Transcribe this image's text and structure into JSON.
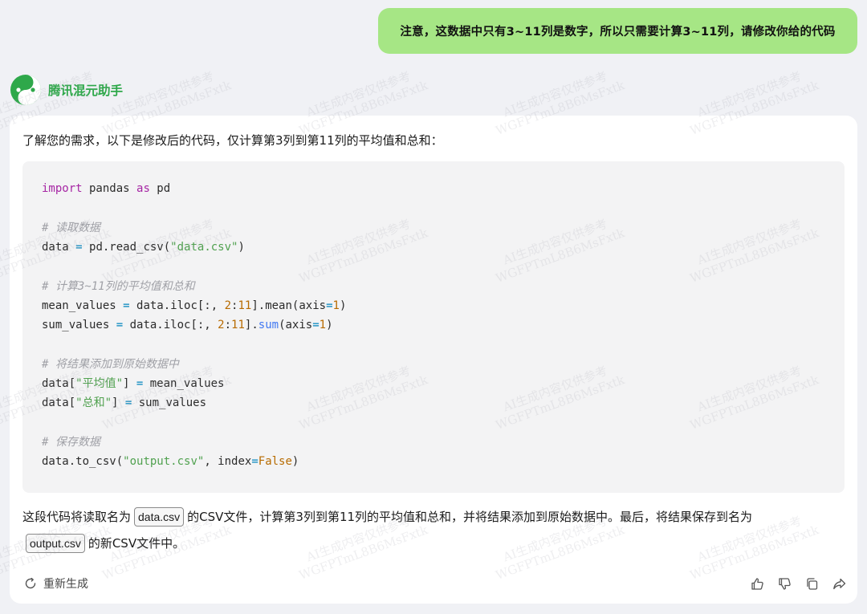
{
  "user_message": {
    "text": "注意，这数据中只有3~11列是数字，所以只需要计算3~11列，请修改你给的代码"
  },
  "assistant": {
    "name": "腾讯混元助手",
    "logo_icon": "hunyuan-logo-icon"
  },
  "answer": {
    "intro": "了解您的需求，以下是修改后的代码，仅计算第3列到第11列的平均值和总和：",
    "code_lines": {
      "l1": {
        "kw": "import",
        "a": " pandas ",
        "kw2": "as",
        "b": " pd"
      },
      "l2": "# 读取数据",
      "l3": {
        "a": "data ",
        "op": "=",
        "b": " pd.read_csv(",
        "str": "\"data.csv\"",
        "c": ")"
      },
      "l4": "# 计算3~11列的平均值和总和",
      "l5": {
        "a": "mean_values ",
        "op": "=",
        "b": " data.iloc[:, ",
        "n1": "2",
        "c": ":",
        "n2": "11",
        "d": "].mean(axis",
        "op2": "=",
        "n3": "1",
        "e": ")"
      },
      "l6": {
        "a": "sum_values ",
        "op": "=",
        "b": " data.iloc[:, ",
        "n1": "2",
        "c": ":",
        "n2": "11",
        "d": "].",
        "fn": "sum",
        "e": "(axis",
        "op2": "=",
        "n3": "1",
        "f": ")"
      },
      "l7": "# 将结果添加到原始数据中",
      "l8": {
        "a": "data[",
        "str": "\"平均值\"",
        "b": "] ",
        "op": "=",
        "c": " mean_values"
      },
      "l9": {
        "a": "data[",
        "str": "\"总和\"",
        "b": "] ",
        "op": "=",
        "c": " sum_values"
      },
      "l10": "# 保存数据",
      "l11": {
        "a": "data.to_csv(",
        "str": "\"output.csv\"",
        "b": ", index",
        "op": "=",
        "bool": "False",
        "c": ")"
      }
    },
    "explain_part1": "这段代码将读取名为",
    "file_in": "data.csv",
    "explain_part2": "的CSV文件，计算第3列到第11列的平均值和总和，并将结果添加到原始数据中。最后，将结果保存到名为",
    "file_out": "output.csv",
    "explain_part3": "的新CSV文件中。"
  },
  "footer": {
    "regenerate_label": "重新生成",
    "regenerate_icon": "refresh-icon",
    "actions": [
      "thumbs-up-icon",
      "thumbs-down-icon",
      "copy-icon",
      "share-icon"
    ]
  },
  "watermark": {
    "line1": "AI生成内容仅供参考",
    "line2": "WGFPTmL8B6MsFxtk"
  },
  "colors": {
    "user_bubble": "#a6e685",
    "brand_green": "#2ea84a",
    "background": "#f0f1f5",
    "code_bg": "#f3f3f4"
  }
}
